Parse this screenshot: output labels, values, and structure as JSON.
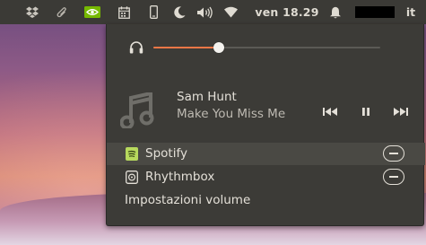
{
  "topbar": {
    "icons": [
      "dropbox-icon",
      "paperclip-icon",
      "nvidia-icon",
      "calendar-icon",
      "phone-icon",
      "moon-icon",
      "volume-icon",
      "wifi-icon",
      "bell-icon"
    ],
    "clock": "ven 18.29",
    "language": "it"
  },
  "sound_menu": {
    "volume_percent": 29,
    "accent_color": "#f07746",
    "player": {
      "artist": "Sam Hunt",
      "title": "Make You Miss Me",
      "controls": [
        "previous-icon",
        "pause-icon",
        "next-icon"
      ]
    },
    "apps": [
      {
        "name": "Spotify",
        "icon": "spotify-icon",
        "selected": true
      },
      {
        "name": "Rhythmbox",
        "icon": "rhythmbox-icon",
        "selected": false
      }
    ],
    "settings_label": "Impostazioni volume"
  }
}
